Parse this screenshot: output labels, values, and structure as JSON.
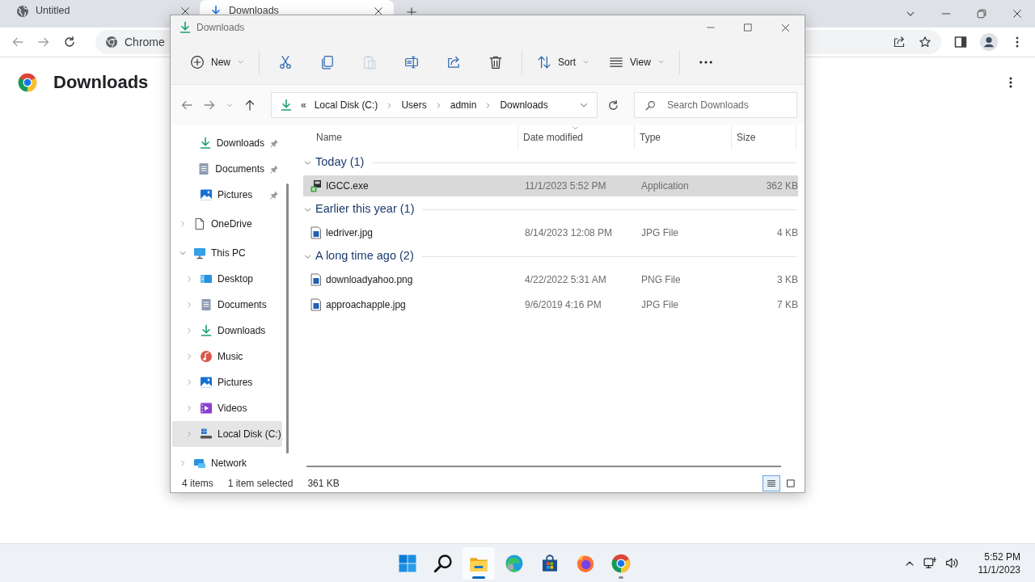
{
  "browser": {
    "tabs": [
      {
        "title": "Untitled",
        "kind": "web",
        "selected": false
      },
      {
        "title": "Downloads",
        "kind": "downloads",
        "selected": true
      }
    ],
    "omnibox": {
      "text": "Chrome"
    },
    "page_title": "Downloads"
  },
  "explorer": {
    "title": "Downloads",
    "command_groups": [
      [
        {
          "kind": "new",
          "label": "New",
          "disabled": false
        }
      ],
      [
        {
          "kind": "cut",
          "disabled": false
        },
        {
          "kind": "copy",
          "disabled": false
        },
        {
          "kind": "paste",
          "disabled": true
        },
        {
          "kind": "rename",
          "disabled": false
        },
        {
          "kind": "share",
          "disabled": false
        },
        {
          "kind": "delete",
          "disabled": false
        }
      ],
      [
        {
          "kind": "sort",
          "label": "Sort",
          "disabled": false
        },
        {
          "kind": "view",
          "label": "View",
          "disabled": false
        }
      ],
      [
        {
          "kind": "more",
          "disabled": false
        }
      ]
    ],
    "breadcrumb_overflow": "«",
    "breadcrumb": [
      "Local Disk (C:)",
      "Users",
      "admin",
      "Downloads"
    ],
    "search": {
      "placeholder": "Search Downloads"
    },
    "sidebar": {
      "items": [
        {
          "label": "Downloads",
          "kind": "download",
          "pinned": true,
          "selected": false
        },
        {
          "label": "Documents",
          "kind": "documents",
          "pinned": true,
          "selected": false
        },
        {
          "label": "Pictures",
          "kind": "pictures",
          "pinned": true,
          "selected": false
        },
        {
          "label": "OneDrive",
          "kind": "file",
          "expanded": false,
          "selected": false
        },
        {
          "label": "This PC",
          "kind": "monitor",
          "expanded": true,
          "selected": false,
          "children": [
            {
              "label": "Desktop",
              "kind": "desktop",
              "expanded": false,
              "selected": false
            },
            {
              "label": "Documents",
              "kind": "documents",
              "expanded": false,
              "selected": false
            },
            {
              "label": "Downloads",
              "kind": "download",
              "expanded": false,
              "selected": false
            },
            {
              "label": "Music",
              "kind": "music",
              "expanded": false,
              "selected": false
            },
            {
              "label": "Pictures",
              "kind": "pictures",
              "expanded": false,
              "selected": false
            },
            {
              "label": "Videos",
              "kind": "videos",
              "expanded": false,
              "selected": false
            },
            {
              "label": "Local Disk (C:)",
              "kind": "drive",
              "expanded": false,
              "selected": true
            }
          ]
        },
        {
          "label": "Network",
          "kind": "network",
          "expanded": false,
          "selected": false
        }
      ]
    },
    "columns": [
      {
        "label": "Name",
        "sorted": false
      },
      {
        "label": "Date modified",
        "sorted": true
      },
      {
        "label": "Type",
        "sorted": false
      },
      {
        "label": "Size",
        "sorted": false
      }
    ],
    "groups": [
      {
        "label": "Today (1)",
        "expanded": true,
        "rows": [
          {
            "name": "IGCC.exe",
            "kind": "app",
            "date": "11/1/2023 5:52 PM",
            "type": "Application",
            "size": "362 KB",
            "selected": true
          }
        ]
      },
      {
        "label": "Earlier this year (1)",
        "expanded": true,
        "rows": [
          {
            "name": "ledriver.jpg",
            "kind": "image",
            "date": "8/14/2023 12:08 PM",
            "type": "JPG File",
            "size": "4 KB",
            "selected": false
          }
        ]
      },
      {
        "label": "A long time ago (2)",
        "expanded": true,
        "rows": [
          {
            "name": "downloadyahoo.png",
            "kind": "image",
            "date": "4/22/2022 5:31 AM",
            "type": "PNG File",
            "size": "3 KB",
            "selected": false
          },
          {
            "name": "approachapple.jpg",
            "kind": "image",
            "date": "9/6/2019 4:16 PM",
            "type": "JPG File",
            "size": "7 KB",
            "selected": false
          }
        ]
      }
    ],
    "status_bar": {
      "count": "4 items",
      "selection": "1 item selected",
      "size": "361 KB"
    },
    "views": [
      {
        "kind": "details",
        "selected": true
      },
      {
        "kind": "tiles",
        "selected": false
      }
    ]
  },
  "taskbar": {
    "apps": [
      {
        "kind": "start",
        "active": false,
        "running": false
      },
      {
        "kind": "search",
        "active": false,
        "running": false
      },
      {
        "kind": "explorer",
        "active": true,
        "running": true
      },
      {
        "kind": "edge",
        "active": false,
        "running": false
      },
      {
        "kind": "store",
        "active": false,
        "running": false
      },
      {
        "kind": "firefox",
        "active": false,
        "running": false
      },
      {
        "kind": "chrome",
        "active": false,
        "running": true
      }
    ],
    "time": "5:52 PM",
    "date": "11/1/2023"
  }
}
